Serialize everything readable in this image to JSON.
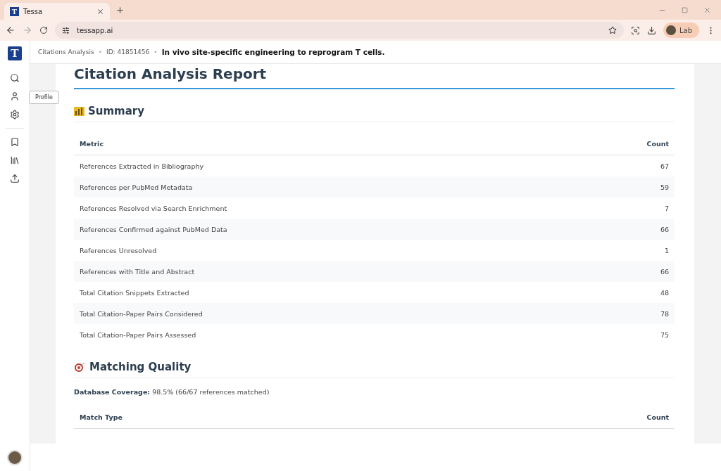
{
  "browser": {
    "favicon": "T",
    "tab_title": "Tessa",
    "url": "tessapp.ai",
    "profile": "Lab"
  },
  "app": {
    "logo": "T",
    "breadcrumb": [
      {
        "text": "Citations Analysis",
        "kind": "link"
      },
      {
        "text": "•",
        "kind": "sep"
      },
      {
        "text": "ID: 41851456",
        "kind": "id"
      },
      {
        "text": "•",
        "kind": "sep"
      },
      {
        "text": "In vivo site-specific engineering to reprogram T cells.",
        "kind": "title"
      }
    ],
    "tooltip": "Profile"
  },
  "report": {
    "title": "Citation Analysis Report",
    "summary": {
      "heading": "Summary",
      "columns": [
        "Metric",
        "Count"
      ],
      "rows": [
        [
          "References Extracted in Bibliography",
          "67"
        ],
        [
          "References per PubMed Metadata",
          "59"
        ],
        [
          "References Resolved via Search Enrichment",
          "7"
        ],
        [
          "References Confirmed against PubMed Data",
          "66"
        ],
        [
          "References Unresolved",
          "1"
        ],
        [
          "References with Title and Abstract",
          "66"
        ],
        [
          "Total Citation Snippets Extracted",
          "48"
        ],
        [
          "Total Citation-Paper Pairs Considered",
          "78"
        ],
        [
          "Total Citation-Paper Pairs Assessed",
          "75"
        ]
      ]
    },
    "matching": {
      "heading": "Matching Quality",
      "coverage": "**Database Coverage:** 98.5% (66/67 references matched)",
      "columns": [
        "Match Type",
        "Count"
      ]
    }
  }
}
